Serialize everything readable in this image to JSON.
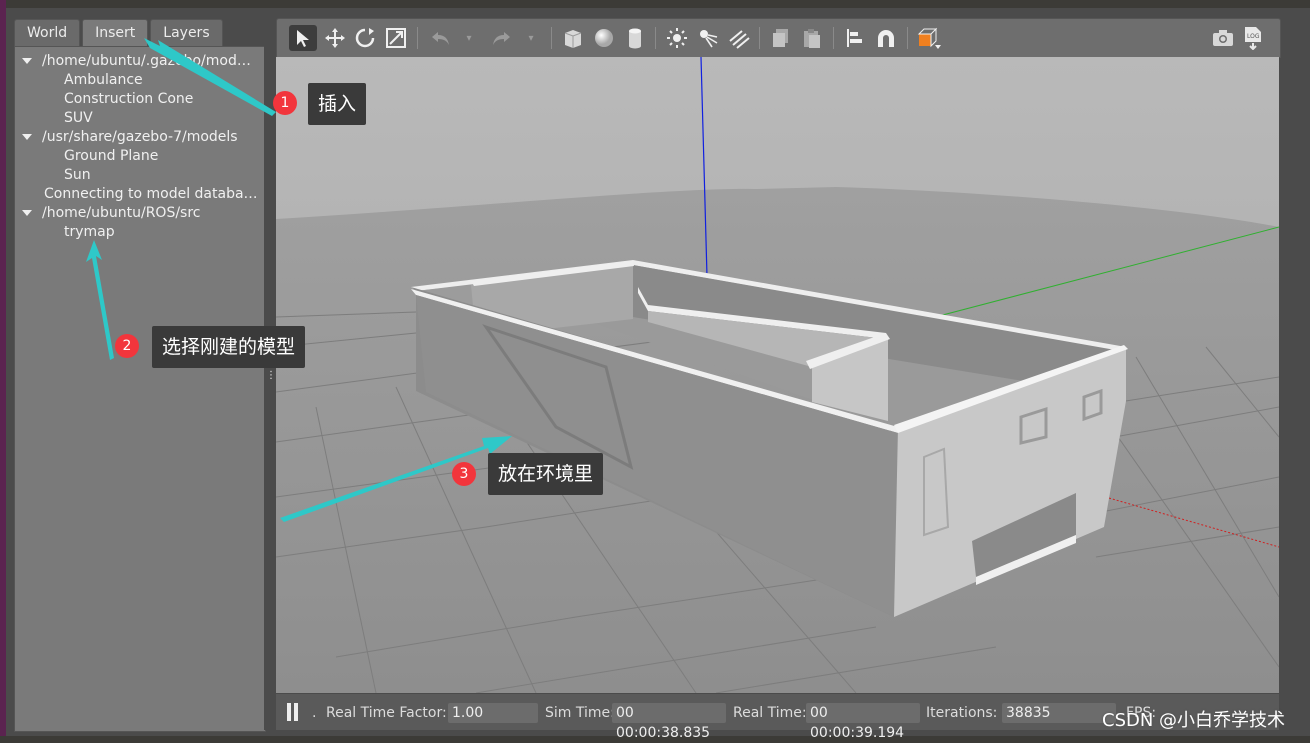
{
  "left_panel": {
    "tabs": [
      {
        "label": "World"
      },
      {
        "label": "Insert"
      },
      {
        "label": "Layers"
      }
    ],
    "tree": [
      {
        "label": "/home/ubuntu/.gazebo/models",
        "type": "folder"
      },
      {
        "label": "Ambulance",
        "type": "child"
      },
      {
        "label": "Construction Cone",
        "type": "child"
      },
      {
        "label": "SUV",
        "type": "child"
      },
      {
        "label": "/usr/share/gazebo-7/models",
        "type": "folder"
      },
      {
        "label": "Ground Plane",
        "type": "child"
      },
      {
        "label": "Sun",
        "type": "child"
      },
      {
        "label": "Connecting to model database...",
        "type": "plain"
      },
      {
        "label": "/home/ubuntu/ROS/src",
        "type": "folder"
      },
      {
        "label": "trymap",
        "type": "child"
      }
    ]
  },
  "toolbar": {
    "icons": [
      "select-arrow-icon",
      "translate-icon",
      "rotate-icon",
      "scale-icon",
      "undo-icon",
      "redo-icon",
      "box-icon",
      "sphere-icon",
      "cylinder-icon",
      "point-light-icon",
      "spot-light-icon",
      "directional-light-icon",
      "copy-icon",
      "paste-icon",
      "align-icon",
      "snap-icon",
      "view-angle-icon",
      "screenshot-icon",
      "log-icon"
    ]
  },
  "status": {
    "real_time_factor_label": "Real Time Factor:",
    "real_time_factor": "1.00",
    "sim_time_label": "Sim Time:",
    "sim_time": "00 00:00:38.835",
    "real_time_label": "Real Time:",
    "real_time": "00 00:00:39.194",
    "iterations_label": "Iterations:",
    "iterations": "38835",
    "fps_label": "FPS:"
  },
  "annotations": [
    {
      "number": "1",
      "text": "插入"
    },
    {
      "number": "2",
      "text": "选择刚建的模型"
    },
    {
      "number": "3",
      "text": "放在环境里"
    }
  ],
  "watermark": "CSDN @小白乔学技术",
  "colors": {
    "annotation_arrow": "#2ec8c8",
    "badge": "#f2353c",
    "panel": "#7a7a7a",
    "viewport_bg": "#a3a3a3"
  }
}
